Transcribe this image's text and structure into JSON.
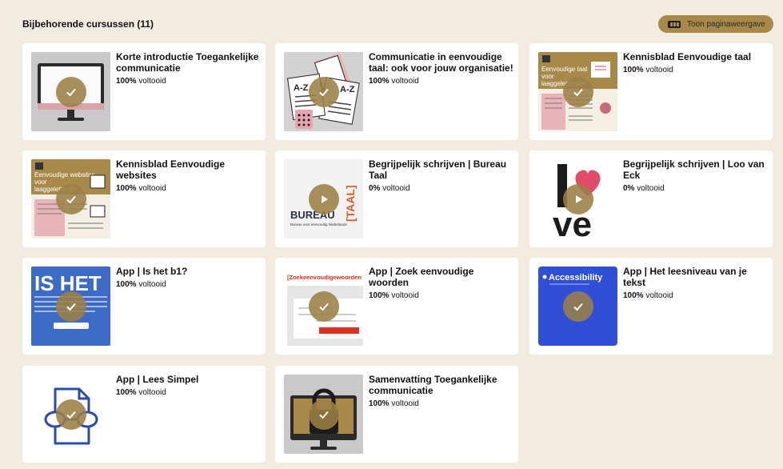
{
  "header": {
    "title": "Bijbehorende cursussen (11)",
    "toggle_label": "Toon paginaweergave"
  },
  "colors": {
    "background": "#f2ece0",
    "accent_gold": "#a8894a",
    "badge_overlay": "#9b8046"
  },
  "courses": [
    {
      "title": "Korte introductie Toegankelijke communicatie",
      "percent": "100%",
      "status": "voltooid",
      "badge": "check-icon"
    },
    {
      "title": "Communicatie in eenvoudige taal: ook voor jouw organisatie!",
      "percent": "100%",
      "status": "voltooid",
      "badge": "check-icon"
    },
    {
      "title": "Kennisblad Eenvoudige taal",
      "percent": "100%",
      "status": "voltooid",
      "badge": "check-icon",
      "thumb_text": "Eenvoudige taal voor laaggeletterden"
    },
    {
      "title": "Kennisblad Eenvoudige websites",
      "percent": "100%",
      "status": "voltooid",
      "badge": "check-icon",
      "thumb_text": "Eenvoudige websites voor laaggeletterden"
    },
    {
      "title": "Begrijpelijk schrijven | Bureau Taal",
      "percent": "0%",
      "status": "voltooid",
      "badge": "play-icon",
      "thumb_text": "BUREAU",
      "thumb_text2": "[TAAL]",
      "thumb_text3": "Bureau voor eenvoudig Nederlands"
    },
    {
      "title": "Begrijpelijk schrijven | Loo van Eck",
      "percent": "0%",
      "status": "voltooid",
      "badge": "play-icon",
      "thumb_text": "l",
      "thumb_text2": "ve"
    },
    {
      "title": "App | Is het b1?",
      "percent": "100%",
      "status": "voltooid",
      "badge": "check-icon",
      "thumb_text": "IS HET"
    },
    {
      "title": "App | Zoek eenvoudige woorden",
      "percent": "100%",
      "status": "voltooid",
      "badge": "check-icon",
      "thumb_text": "[Zoekeenvoudigewoorden"
    },
    {
      "title": "App | Het leesniveau van je tekst",
      "percent": "100%",
      "status": "voltooid",
      "badge": "check-icon",
      "thumb_text": "Accessibility"
    },
    {
      "title": "App | Lees Simpel",
      "percent": "100%",
      "status": "voltooid",
      "badge": "check-icon"
    },
    {
      "title": "Samenvatting Toegankelijke communicatie",
      "percent": "100%",
      "status": "voltooid",
      "badge": "check-icon"
    }
  ]
}
